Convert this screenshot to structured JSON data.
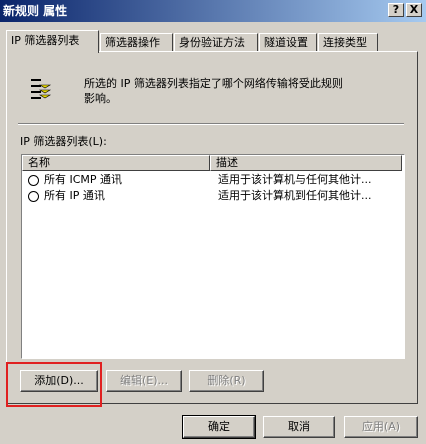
{
  "window": {
    "title": "新规则 属性",
    "help_label": "?",
    "close_label": "X"
  },
  "tabs": [
    {
      "label": "IP 筛选器列表",
      "active": true
    },
    {
      "label": "筛选器操作"
    },
    {
      "label": "身份验证方法"
    },
    {
      "label": "隧道设置"
    },
    {
      "label": "连接类型"
    }
  ],
  "description": {
    "line1": "所选的 IP 筛选器列表指定了哪个网络传输将受此规则",
    "line2": "影响。"
  },
  "filter_list": {
    "label": "IP 筛选器列表(L):",
    "columns": {
      "name": "名称",
      "description": "描述"
    },
    "rows": [
      {
        "name": "所有 ICMP 通讯",
        "description": "适用于该计算机与任何其他计..."
      },
      {
        "name": "所有 IP 通讯",
        "description": "适用于该计算机到任何其他计..."
      }
    ]
  },
  "actions": {
    "add": "添加(D)...",
    "edit": "编辑(E)...",
    "remove": "删除(R)"
  },
  "footer": {
    "ok": "确定",
    "cancel": "取消",
    "apply": "应用(A)"
  },
  "colors": {
    "highlight_border": "#e02020",
    "titlebar_start": "#0a246a",
    "titlebar_end": "#a6caf0"
  },
  "icons": {
    "filter": "filter-list-icon"
  }
}
